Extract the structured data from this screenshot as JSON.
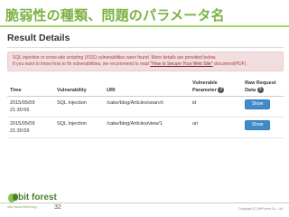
{
  "slide": {
    "title": "脆弱性の種類、問題のパラメータ名"
  },
  "section": {
    "heading": "Result Details"
  },
  "alert": {
    "line1": "SQL injection or cross-site scripting (XSS) vulnerabilities were found. More details are provided below.",
    "line2_prefix": "If you want to know how to fix vulnerabilities, we recommend to read ",
    "line2_link": "\"How to Secure Your Web Site\"",
    "line2_suffix": " document(PDF)."
  },
  "results": {
    "headers": {
      "time": "Time",
      "vulnerability": "Vulnerability",
      "uri": "URI",
      "param_line1": "Vulnerable",
      "param_line2": "Parameter",
      "request_line1": "Raw Request Data",
      "help_symbol": "?"
    },
    "rows": [
      {
        "date": "2015/05/09",
        "time": "21:30:56",
        "vulnerability": "SQL Injection",
        "uri": "/cake/blog/Articles/search",
        "parameter": "id",
        "button": "Show"
      },
      {
        "date": "2015/05/09",
        "time": "21:30:59",
        "vulnerability": "SQL Injection",
        "uri": "/cake/blog/Articles/view/1",
        "parameter": "uri",
        "button": "Show"
      }
    ]
  },
  "footer": {
    "logo_text": "bit forest",
    "tagline": "http://www.bitforest.jp",
    "page_number": "32",
    "copyright": "Copyright (C) BitForest Co., Ltd."
  },
  "colors": {
    "title_green": "#7cb342",
    "alert_bg": "#f2dede",
    "alert_text": "#a94442",
    "button_blue": "#428bca"
  }
}
